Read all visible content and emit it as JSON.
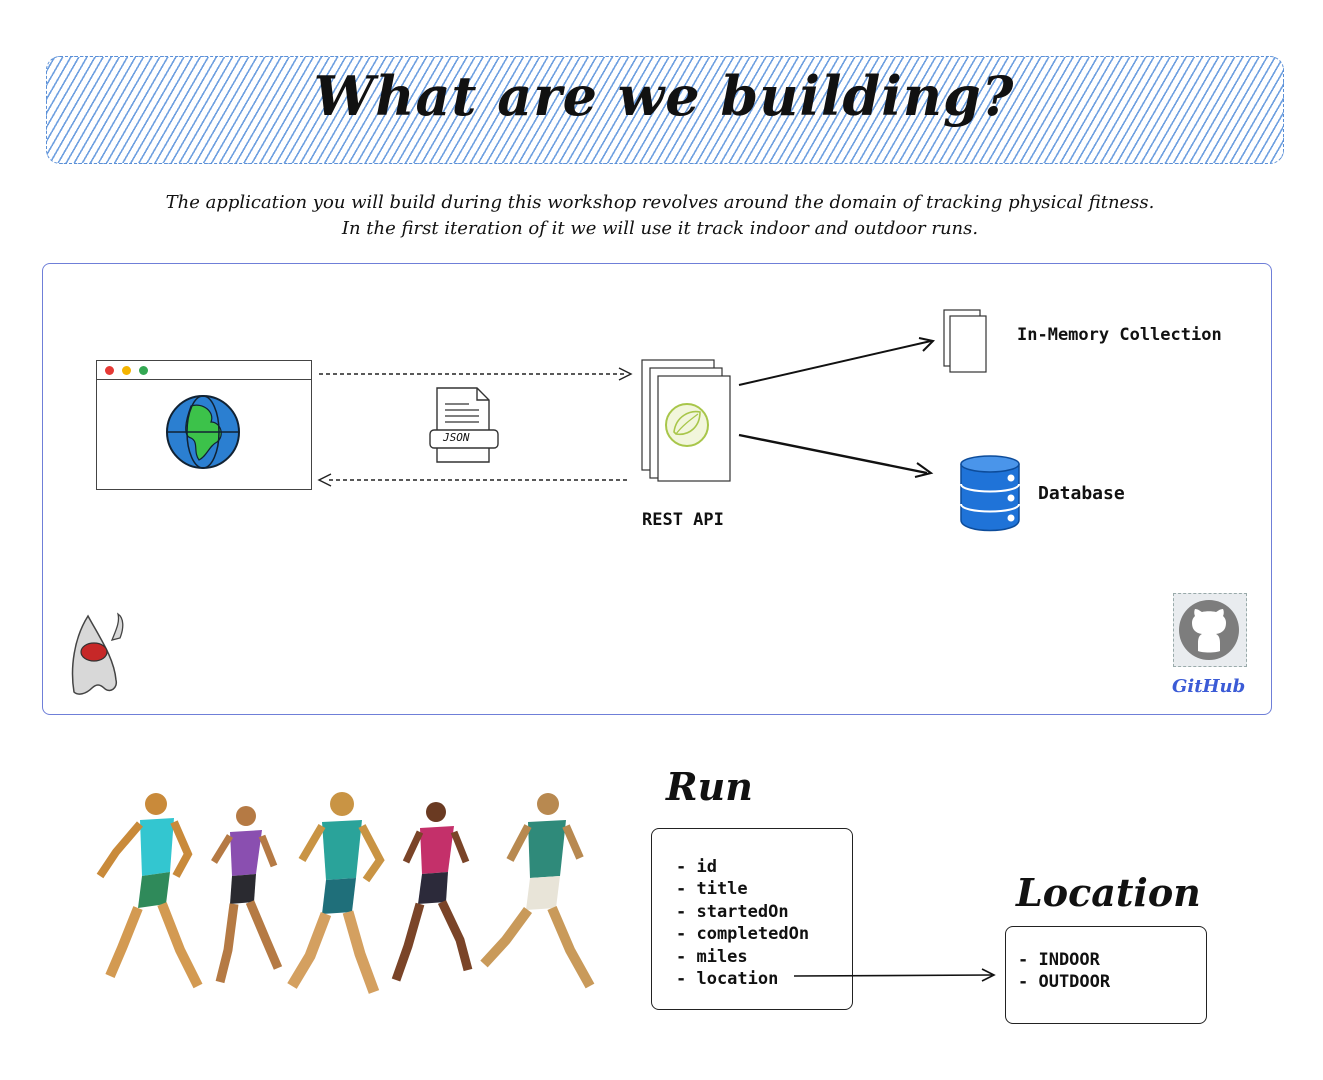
{
  "title": "What are we building?",
  "description": {
    "line1": "The application you will build during this workshop revolves around the domain of tracking physical fitness.",
    "line2": "In the first iteration of it we will use it track indoor and outdoor runs."
  },
  "architecture": {
    "json_label": "JSON",
    "rest_api_label": "REST API",
    "in_memory_label": "In-Memory Collection",
    "database_label": "Database",
    "github_label": "GitHub"
  },
  "run_model": {
    "title": "Run",
    "fields": [
      "- id",
      "- title",
      "- startedOn",
      "- completedOn",
      "- miles",
      "- location"
    ]
  },
  "location_model": {
    "title": "Location",
    "values": [
      "- INDOOR",
      "- OUTDOOR"
    ]
  },
  "colors": {
    "banner_hatch": "#6fa0e0",
    "frame_border": "#6f7fd8",
    "db_blue": "#1f73d8",
    "globe_blue": "#2b7fd1",
    "globe_green": "#3cc24a",
    "spring_green": "#a8c64a",
    "github_blue": "#3b5bd6"
  }
}
